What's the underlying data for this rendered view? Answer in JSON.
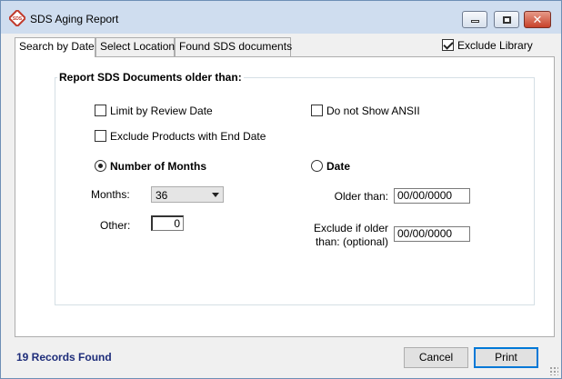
{
  "window": {
    "title": "SDS Aging Report",
    "icon_text": "SDS",
    "controls": [
      "minimize-icon",
      "maximize-icon",
      "close-icon"
    ]
  },
  "tabs": [
    {
      "label": "Search by Date",
      "active": true
    },
    {
      "label": "Select Location",
      "active": false
    },
    {
      "label": "Found SDS documents",
      "active": false
    }
  ],
  "exclude_library": {
    "label": "Exclude Library",
    "checked": true
  },
  "group": {
    "title": "Report SDS Documents older than:"
  },
  "options": {
    "limit_review": {
      "label": "Limit by Review Date",
      "checked": false
    },
    "do_not_show_ansii": {
      "label": "Do not Show ANSII",
      "checked": false
    },
    "exclude_end_date": {
      "label": "Exclude Products with End Date",
      "checked": false
    }
  },
  "mode": {
    "months": {
      "label": "Number of Months",
      "selected": true
    },
    "date": {
      "label": "Date",
      "selected": false
    }
  },
  "months_field": {
    "label": "Months:",
    "value": "36"
  },
  "other_field": {
    "label": "Other:",
    "value": "0"
  },
  "older_than": {
    "label": "Older than:",
    "value": "00/00/0000"
  },
  "exclude_if_older": {
    "label_line1": "Exclude if older",
    "label_line2": "than: (optional)",
    "value": "00/00/0000"
  },
  "footer": {
    "records": "19 Records Found",
    "cancel": "Cancel",
    "print": "Print"
  },
  "colors": {
    "accent": "#0078d7",
    "records_text": "#1e2d7a",
    "title_bar": "#cfddef"
  }
}
